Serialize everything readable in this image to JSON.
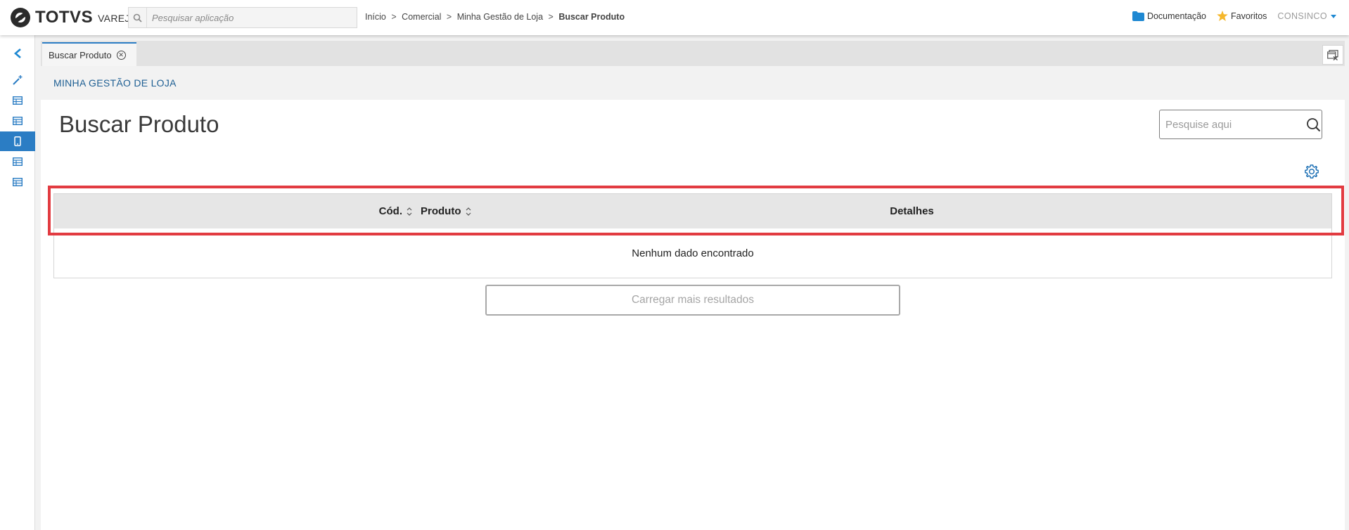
{
  "header": {
    "brand": "TOTVS",
    "brand_sub": "VAREJO",
    "app_search_placeholder": "Pesquisar aplicação",
    "breadcrumb": {
      "items": [
        "Início",
        "Comercial",
        "Minha Gestão de Loja"
      ],
      "separator": ">",
      "current": "Buscar Produto"
    },
    "documentation_label": "Documentação",
    "favorites_label": "Favoritos",
    "user_label": "CONSINCO"
  },
  "sidebar": {
    "items": [
      {
        "icon": "chevron-left-icon"
      },
      {
        "icon": "wand-icon"
      },
      {
        "icon": "table-icon"
      },
      {
        "icon": "table-icon"
      },
      {
        "icon": "mobile-icon",
        "active": true
      },
      {
        "icon": "table-icon"
      },
      {
        "icon": "table-icon"
      }
    ]
  },
  "tabs": {
    "items": [
      {
        "label": "Buscar Produto",
        "active": true
      }
    ]
  },
  "page": {
    "section": "MINHA GESTÃO DE LOJA",
    "title": "Buscar Produto",
    "search_placeholder": "Pesquise aqui",
    "table": {
      "columns": [
        "Cód.",
        "Produto",
        "Detalhes"
      ],
      "empty_message": "Nenhum dado encontrado"
    },
    "load_more_label": "Carregar mais resultados"
  },
  "colors": {
    "accent": "#2b7dc4",
    "section_text": "#1e5f93",
    "highlight": "#e23b41",
    "favorite_star": "#f5b72b",
    "folder": "#1e88d2"
  }
}
